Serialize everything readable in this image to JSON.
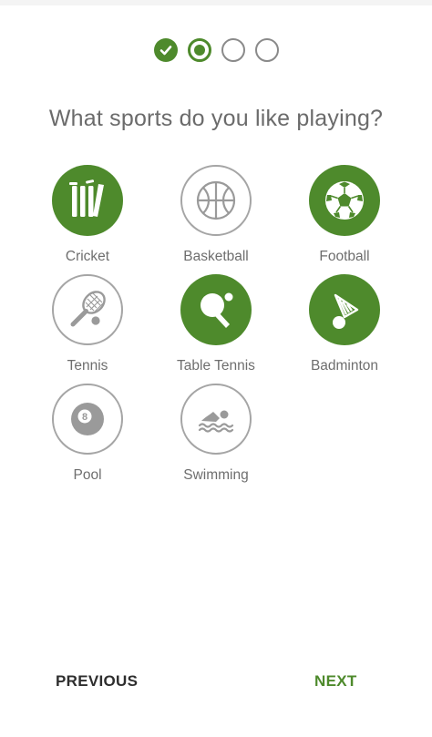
{
  "colors": {
    "accent": "#4e8a2c",
    "inactive_outline": "#a5a5a5",
    "text": "#6b6b6b"
  },
  "stepper": {
    "steps": [
      {
        "state": "completed",
        "icon": "check-icon"
      },
      {
        "state": "current"
      },
      {
        "state": "upcoming"
      },
      {
        "state": "upcoming"
      }
    ]
  },
  "question": "What sports do you like playing?",
  "sports": [
    {
      "label": "Cricket",
      "selected": true,
      "icon": "cricket-icon"
    },
    {
      "label": "Basketball",
      "selected": false,
      "icon": "basketball-icon"
    },
    {
      "label": "Football",
      "selected": true,
      "icon": "football-icon"
    },
    {
      "label": "Tennis",
      "selected": false,
      "icon": "tennis-icon"
    },
    {
      "label": "Table Tennis",
      "selected": true,
      "icon": "table-tennis-icon"
    },
    {
      "label": "Badminton",
      "selected": true,
      "icon": "badminton-icon"
    },
    {
      "label": "Pool",
      "selected": false,
      "icon": "pool-ball-icon"
    },
    {
      "label": "Swimming",
      "selected": false,
      "icon": "swimming-icon"
    }
  ],
  "footer": {
    "previous_label": "PREVIOUS",
    "next_label": "NEXT"
  }
}
